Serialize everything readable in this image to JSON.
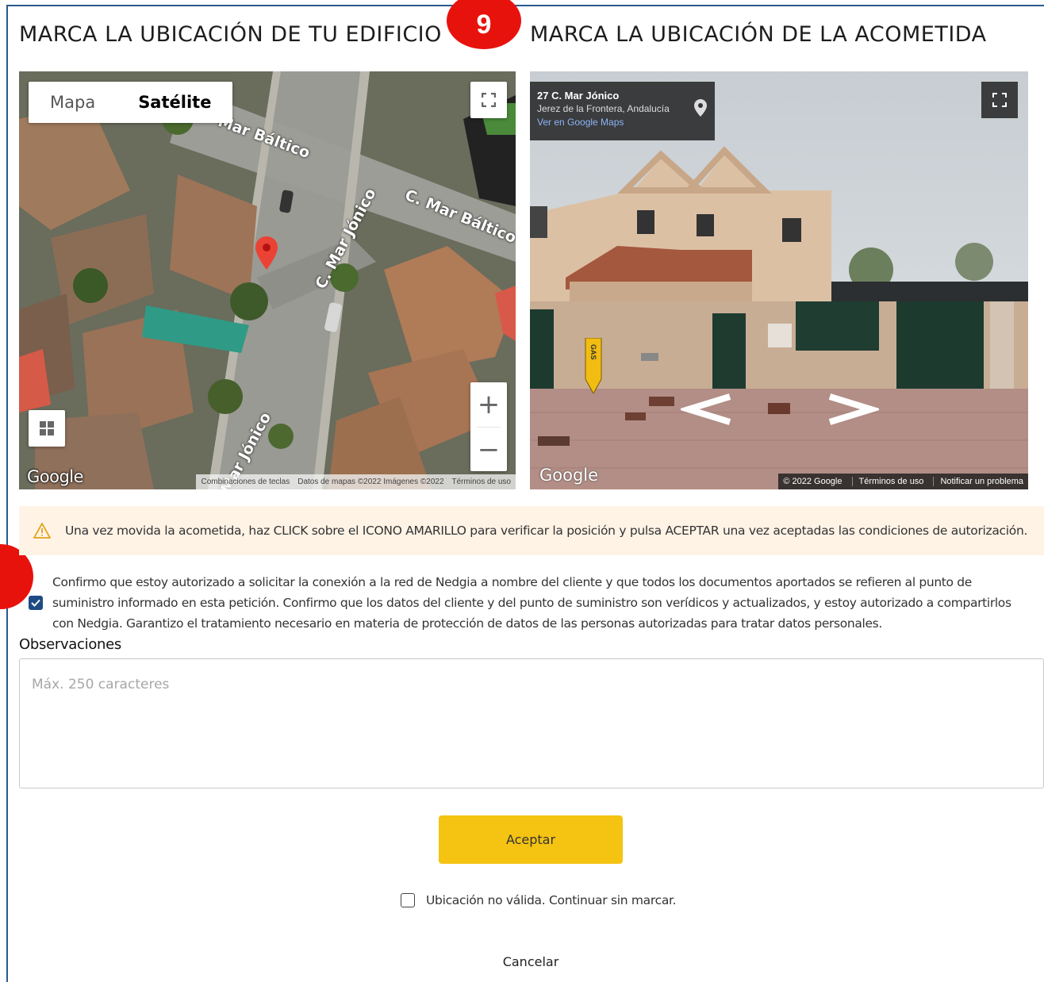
{
  "header": {
    "left_title": "MARCA LA UBICACIÓN DE TU EDIFICIO",
    "right_title": "MARCA LA UBICACIÓN DE LA ACOMETIDA",
    "step_badge": "9"
  },
  "map": {
    "type_options": [
      "Mapa",
      "Satélite"
    ],
    "selected_type": "Satélite",
    "street_labels": [
      "Mar Báltico",
      "C. Mar Jónico",
      "C. Mar Báltico",
      "Mar Jónico"
    ],
    "google_logo": "Google",
    "attribution": [
      "Combinaciones de teclas",
      "Datos de mapas ©2022 Imágenes ©2022",
      "Términos de uso"
    ],
    "icons": [
      "fullscreen-icon",
      "map-marker-icon",
      "pegman-grid-icon",
      "zoom-in-icon",
      "zoom-out-icon"
    ]
  },
  "street_view": {
    "address": "27 C. Mar Jónico",
    "city": "Jerez de la Frontera, Andalucía",
    "maps_link": "Ver en Google Maps",
    "google_logo": "Google",
    "attribution": [
      "© 2022 Google",
      "Términos de uso",
      "Notificar un problema"
    ],
    "marker_label": "GAS",
    "icons": [
      "location-pin-icon",
      "fullscreen-icon",
      "arrow-left-icon",
      "arrow-right-icon",
      "gas-marker-icon"
    ]
  },
  "warning": {
    "text": "Una vez movida la acometida, haz CLICK sobre el ICONO AMARILLO para verificar la posición y pulsa ACEPTAR una vez aceptadas las condiciones de autorización.",
    "color": "#fff3e6",
    "icon": "warning-icon"
  },
  "consent": {
    "checked": true,
    "text": "Confirmo que estoy autorizado a solicitar la conexión a la red de Nedgia a nombre del cliente y que todos los documentos aportados se refieren al punto de suministro informado en esta petición. Confirmo que los datos del cliente y del punto de suministro son verídicos y actualizados, y estoy autorizado a compartirlos con Nedgia. Garantizo el tratamiento necesario en materia de protección de datos de las personas autorizadas para tratar datos personales."
  },
  "observations": {
    "label": "Observaciones",
    "placeholder": "Máx. 250 caracteres",
    "value": ""
  },
  "actions": {
    "accept_label": "Aceptar",
    "accept_color": "#f5c312",
    "invalid_location_label": "Ubicación no válida. Continuar sin marcar.",
    "invalid_location_checked": false,
    "cancel_label": "Cancelar"
  },
  "colors": {
    "badge": "#e8120d",
    "checkbox": "#1f4b84",
    "frame": "#2b5a8a"
  }
}
